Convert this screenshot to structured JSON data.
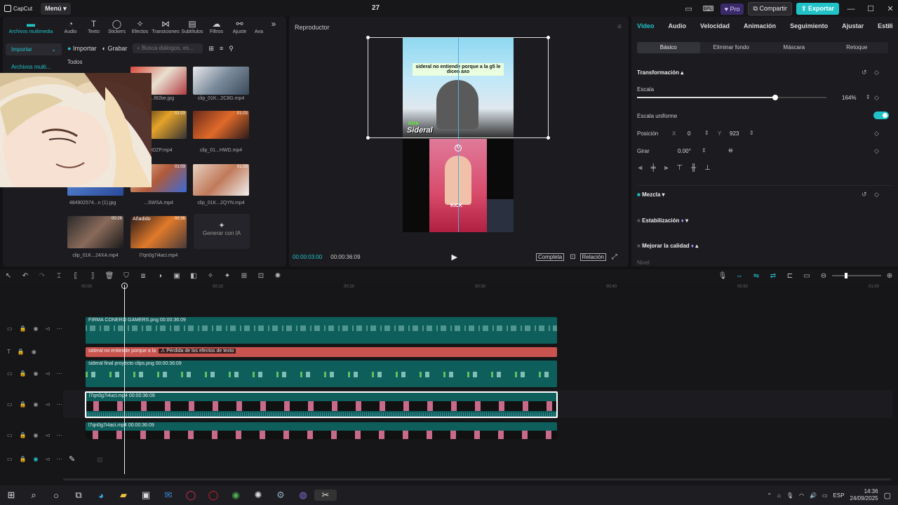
{
  "app": {
    "name": "CapCut",
    "menu_label": "Menú",
    "project_title": "27"
  },
  "topbar": {
    "pro": "Pro",
    "share": "Compartir",
    "export": "Exportar"
  },
  "media_tabs": [
    {
      "label": "Archivos multimedia",
      "icon": "media-icon"
    },
    {
      "label": "Audio",
      "icon": "audio-icon"
    },
    {
      "label": "Texto",
      "icon": "text-icon"
    },
    {
      "label": "Stickers",
      "icon": "sticker-icon"
    },
    {
      "label": "Efectos",
      "icon": "effects-icon"
    },
    {
      "label": "Transiciones",
      "icon": "transition-icon"
    },
    {
      "label": "Subtítulos",
      "icon": "subtitle-icon"
    },
    {
      "label": "Filtros",
      "icon": "filter-icon"
    },
    {
      "label": "Ajuste",
      "icon": "adjust-icon"
    },
    {
      "label": "Ava",
      "icon": "avatar-icon"
    }
  ],
  "media_nav": {
    "import": "Importar",
    "media": "Archivos multi..."
  },
  "media_toolbar": {
    "import": "Importar",
    "record": "Grabar",
    "search_placeholder": "Busca diálogos, es...",
    "filter_all": "Todos"
  },
  "media_items": [
    {
      "label": "...6...f82be.jpg",
      "duration": ""
    },
    {
      "label": "clip_01K...2C8G.mp4",
      "duration": ""
    },
    {
      "label": "...DDZP.mp4",
      "duration": "01:03"
    },
    {
      "label": "clip_01...HWD.mp4",
      "duration": "01:03"
    },
    {
      "label": "484902574...n (1).jpg",
      "duration": ""
    },
    {
      "label": "...SWSA.mp4",
      "duration": "01:03"
    },
    {
      "label": "clip_01K...2QYN.mp4",
      "duration": "01:03"
    },
    {
      "label": "clip_01K...24XA.mp4",
      "duration": "00:26"
    },
    {
      "label": "l7qn0g7i4aci.mp4",
      "duration": "00:36"
    },
    {
      "label": "Generar con IA",
      "duration": ""
    }
  ],
  "media_added_badge": "Añadido",
  "player": {
    "title": "Reproductor",
    "current_time": "00:00:03:00",
    "total_time": "00:00:36:09",
    "full_label": "Completa",
    "ratio_label": "Relación",
    "caption_top": "sideral no entiende porque a la g5 le dicen axo",
    "streamer_name": "Sideral",
    "kick": "KICK"
  },
  "props": {
    "tabs": [
      "Vídeo",
      "Audio",
      "Velocidad",
      "Animación",
      "Seguimiento",
      "Ajustar",
      "Estili"
    ],
    "subtabs": [
      "Básico",
      "Eliminar fondo",
      "Máscara",
      "Retoque"
    ],
    "transform": "Transformación",
    "scale_label": "Escala",
    "scale_value": "164%",
    "scale_fraction": 0.73,
    "uniform_scale": "Escala uniforme",
    "position_label": "Posición",
    "x_label": "X",
    "x_value": "0",
    "y_label": "Y",
    "y_value": "923",
    "rotate_label": "Girar",
    "rotate_value": "0.00°",
    "blend": "Mezcla",
    "stabilize": "Estabilización",
    "enhance": "Mejorar la calidad",
    "level": "Nivel"
  },
  "timeline": {
    "ruler": [
      "00:00",
      "00:10",
      "00:20",
      "00:30",
      "00:40",
      "00:50",
      "01:00"
    ],
    "tracks": [
      {
        "label": "FIRMA CONERO GAMERS.png  00:00:36:09",
        "color": "#0e6a68"
      },
      {
        "label": "sideral no entiende porque a la",
        "warning": "Pérdida de los efectos de texto",
        "color": "#c9544f"
      },
      {
        "label": "sideral final proyecto clips.png  00:00:36:09",
        "color": "#0e6a68"
      },
      {
        "label": "l7qn0g7i4uci.mp4  00:00:36:09",
        "color": "#0e6a68"
      },
      {
        "label": "l7qn0g7i4aci.mp4  00:00:36:09",
        "color": "#0e6a68"
      }
    ]
  },
  "taskbar": {
    "lang": "ESP",
    "time": "14:36",
    "date": "24/09/2025"
  }
}
